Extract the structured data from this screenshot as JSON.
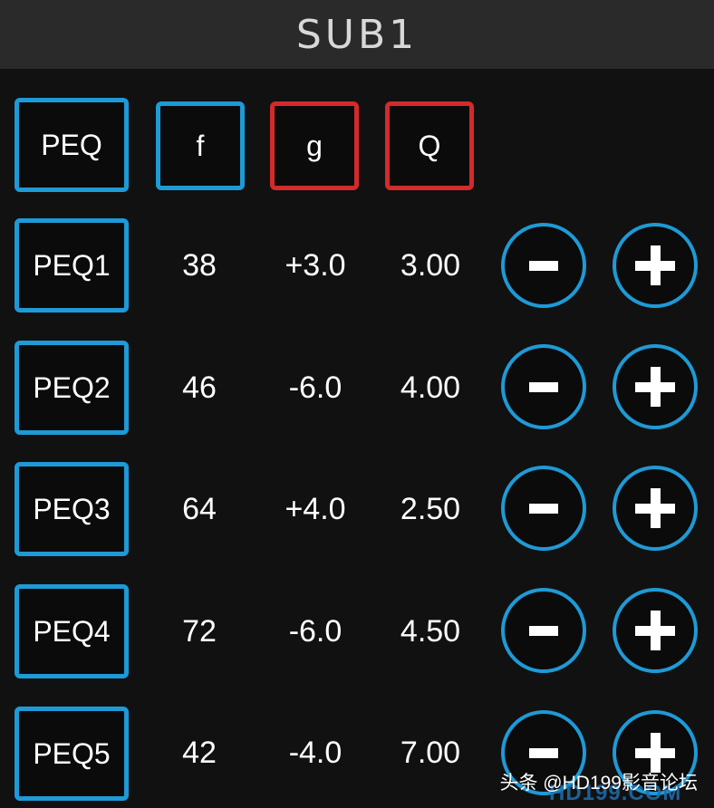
{
  "title": "SUB1",
  "header": {
    "peq": "PEQ",
    "f": "f",
    "g": "g",
    "q": "Q"
  },
  "rows": [
    {
      "label": "PEQ1",
      "f": "38",
      "g": "+3.0",
      "q": "3.00"
    },
    {
      "label": "PEQ2",
      "f": "46",
      "g": "-6.0",
      "q": "4.00"
    },
    {
      "label": "PEQ3",
      "f": "64",
      "g": "+4.0",
      "q": "2.50"
    },
    {
      "label": "PEQ4",
      "f": "72",
      "g": "-6.0",
      "q": "4.50"
    },
    {
      "label": "PEQ5",
      "f": "42",
      "g": "-4.0",
      "q": "7.00"
    }
  ],
  "icons": {
    "minus": "minus-icon",
    "plus": "plus-icon"
  },
  "watermark": {
    "text": "头条 @HD199影音论坛",
    "logo": "HD199.COM"
  },
  "colors": {
    "blue": "#1e9ad6",
    "red": "#d42a2a",
    "background": "#111111",
    "title_bar": "#2a2a2a"
  }
}
